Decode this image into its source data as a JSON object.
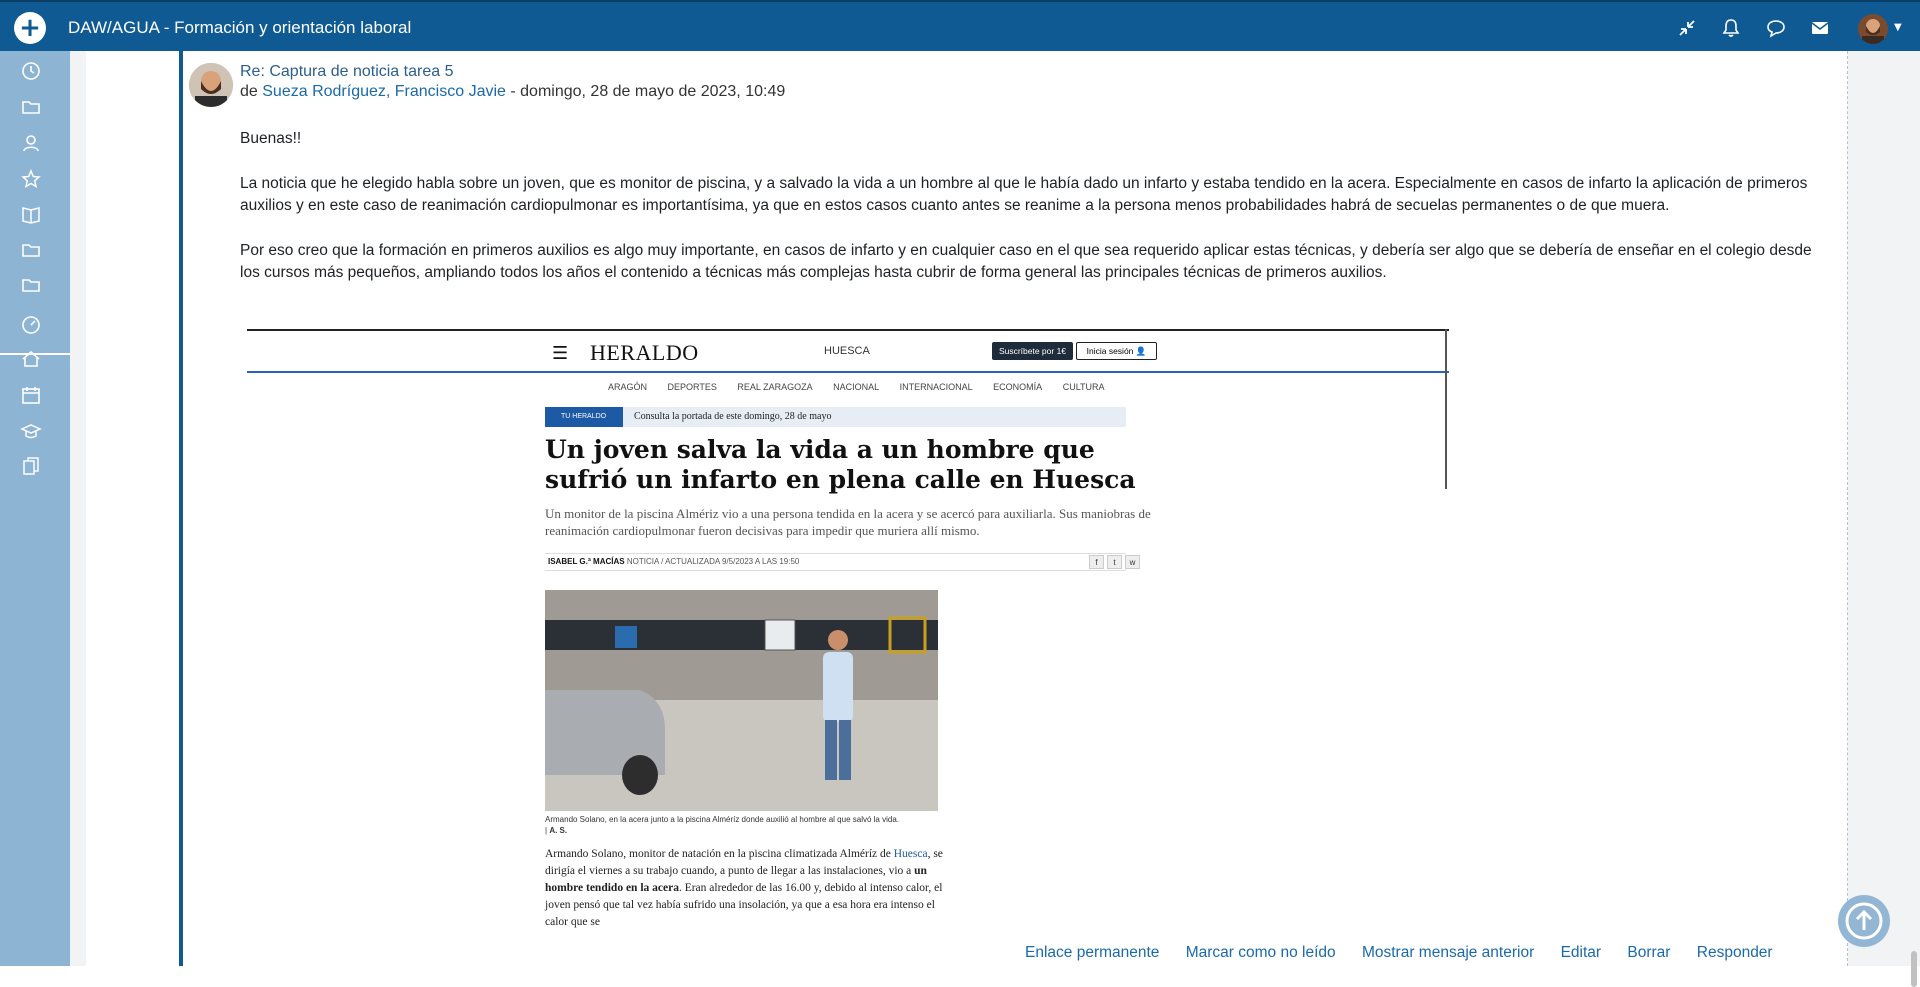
{
  "topbar": {
    "title": "DAW/AGUA - Formación y orientación laboral",
    "icons": [
      "collapse-icon",
      "bell-icon",
      "chat-icon",
      "mail-icon"
    ]
  },
  "sidebar": {
    "icons": [
      "clock-icon",
      "folder-icon",
      "users-icon",
      "star-icon",
      "book-icon",
      "folder-icon",
      "folder-icon",
      "dashboard-icon",
      "home-icon",
      "calendar-icon",
      "graduation-cap-icon",
      "copy-icon"
    ]
  },
  "post": {
    "title": "Re: Captura de noticia tarea 5",
    "meta_prefix": "de",
    "author": "Sueza Rodríguez, Francisco Javie",
    "date": "- domingo, 28 de mayo de 2023, 10:49",
    "paragraphs": [
      "Buenas!!",
      "La noticia que he elegido habla sobre un joven, que es monitor de piscina, y a salvado la vida a un hombre al que le había dado un infarto y estaba tendido en la acera. Especialmente en casos de infarto la aplicación de primeros auxilios y en este caso de reanimación cardiopulmonar es importantísima, ya que en estos casos cuanto antes se reanime a la persona menos probabilidades habrá de secuelas permanentes o de que muera.",
      "Por eso creo que la formación en primeros auxilios es algo muy importante, en casos de infarto y en cualquier caso en el que sea requerido aplicar estas técnicas, y debería ser algo que se debería de enseñar en el colegio desde los cursos más pequeños, ampliando todos los años el contenido a técnicas más complejas hasta cubrir de forma general las principales técnicas de primeros auxilios."
    ],
    "actions": [
      "Enlace permanente",
      "Marcar como no leído",
      "Mostrar mensaje anterior",
      "Editar",
      "Borrar",
      "Responder"
    ]
  },
  "screenshot": {
    "logo": "HERALDO",
    "location": "HUESCA",
    "subscribe": "Suscríbete por 1€",
    "login": "Inicia sesión",
    "nav": [
      "ARAGÓN",
      "DEPORTES",
      "REAL ZARAGOZA",
      "NACIONAL",
      "INTERNACIONAL",
      "ECONOMÍA",
      "CULTURA"
    ],
    "badge": "TU HERALDO",
    "badge_text": "Consulta la portada de este domingo, 28 de mayo",
    "headline": "Un joven salva la vida a un hombre que sufrió un infarto en plena calle en Huesca",
    "lede": "Un monitor de la piscina Almériz vio a una persona tendida en la acera y se acercó para auxiliarla. Sus maniobras de reanimación cardiopulmonar fueron decisivas para impedir que muriera allí mismo.",
    "byline_author": "ISABEL G.ª MACÍAS",
    "byline_rest": "NOTICIA / ACTUALIZADA 9/5/2023 A LAS 19:50",
    "caption": "Armando Solano, en la acera junto a la piscina Alméríz donde auxilió al hombre al que salvó la vida.",
    "caption_credit": "A. S.",
    "article_1": "Armando Solano, monitor de natación en la piscina climatizada Alméríz de ",
    "article_link": "Huesca",
    "article_2": ", se dirigía el viernes a su trabajo cuando, a punto de llegar a las instalaciones, vio a ",
    "article_bold": "un hombre tendido en la acera",
    "article_3": ". Eran alrededor de las 16.00 y, debido al intenso calor, el joven pensó que tal vez había sufrido una insolación, ya que a esa hora era intenso el calor que se"
  }
}
